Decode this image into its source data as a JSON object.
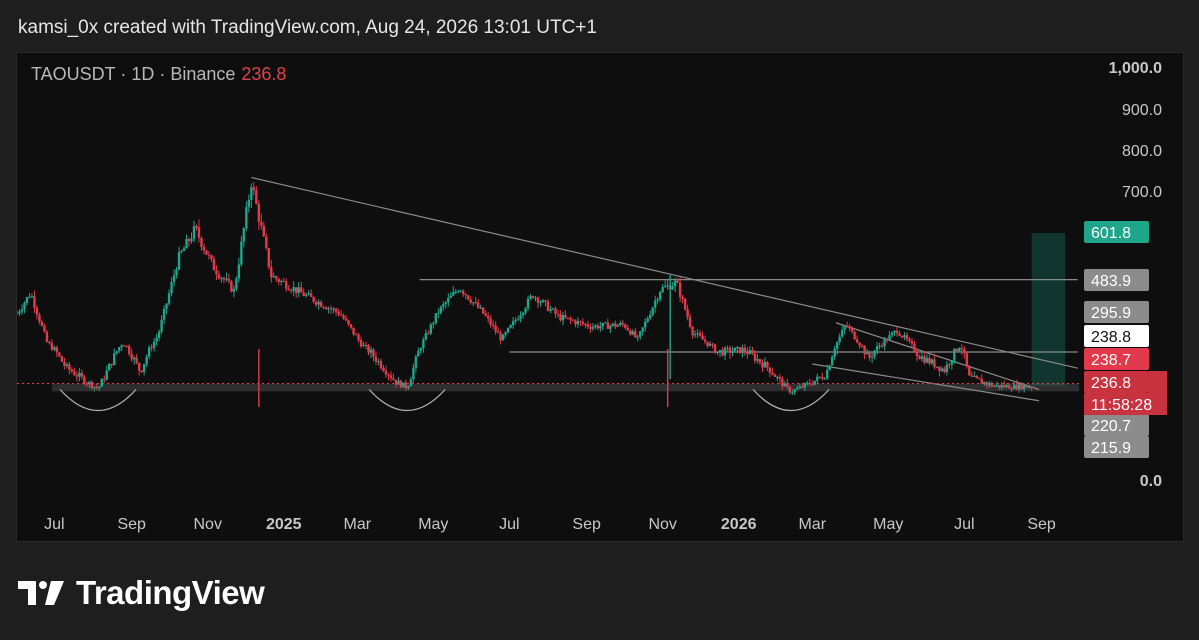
{
  "caption": "kamsi_0x created with TradingView.com, Aug 24, 2026 13:01 UTC+1",
  "header": {
    "symbol_label": "TAOUSDT · 1D · Binance",
    "last_price": "236.8"
  },
  "brand": {
    "name": "TradingView"
  },
  "colors": {
    "up": "#1fa58a",
    "down": "#e23a4a",
    "background": "#0e0e0e",
    "trendline": "#8a8a8a",
    "target_zone": "#123b33"
  },
  "chart_data": {
    "type": "candlestick",
    "title": "TAOUSDT · 1D · Binance",
    "y_scale": "linear-approx",
    "ylim": [
      0,
      1000
    ],
    "x_ticks": [
      {
        "label": "Jul",
        "date": "2024-07-01",
        "bold": false
      },
      {
        "label": "Sep",
        "date": "2024-09-01",
        "bold": false
      },
      {
        "label": "Nov",
        "date": "2024-11-01",
        "bold": false
      },
      {
        "label": "2025",
        "date": "2025-01-01",
        "bold": true
      },
      {
        "label": "Mar",
        "date": "2025-03-01",
        "bold": false
      },
      {
        "label": "May",
        "date": "2025-05-01",
        "bold": false
      },
      {
        "label": "Jul",
        "date": "2025-07-01",
        "bold": false
      },
      {
        "label": "Sep",
        "date": "2025-09-01",
        "bold": false
      },
      {
        "label": "Nov",
        "date": "2025-11-01",
        "bold": false
      },
      {
        "label": "2026",
        "date": "2026-01-01",
        "bold": true
      },
      {
        "label": "Mar",
        "date": "2026-03-01",
        "bold": false
      },
      {
        "label": "May",
        "date": "2026-05-01",
        "bold": false
      },
      {
        "label": "Jul",
        "date": "2026-07-01",
        "bold": false
      },
      {
        "label": "Sep",
        "date": "2026-09-01",
        "bold": false
      }
    ],
    "y_ticks": [
      {
        "label": "1,000.0",
        "value": 1000,
        "bold": true
      },
      {
        "label": "900.0",
        "value": 900,
        "bold": false
      },
      {
        "label": "800.0",
        "value": 800,
        "bold": false
      },
      {
        "label": "700.0",
        "value": 700,
        "bold": false
      },
      {
        "label": "0.0",
        "value": 0,
        "bold": true
      }
    ],
    "price_path": [
      [
        "2024-06-01",
        395
      ],
      [
        "2024-06-12",
        450
      ],
      [
        "2024-06-25",
        318
      ],
      [
        "2024-07-10",
        270
      ],
      [
        "2024-08-05",
        232
      ],
      [
        "2024-08-25",
        318
      ],
      [
        "2024-09-08",
        262
      ],
      [
        "2024-09-22",
        335
      ],
      [
        "2024-10-08",
        535
      ],
      [
        "2024-10-22",
        610
      ],
      [
        "2024-11-05",
        520
      ],
      [
        "2024-11-22",
        455
      ],
      [
        "2024-12-06",
        725
      ],
      [
        "2024-12-22",
        495
      ],
      [
        "2025-01-20",
        440
      ],
      [
        "2025-02-15",
        395
      ],
      [
        "2025-03-05",
        310
      ],
      [
        "2025-04-01",
        245
      ],
      [
        "2025-04-10",
        235
      ],
      [
        "2025-05-05",
        400
      ],
      [
        "2025-05-22",
        465
      ],
      [
        "2025-06-10",
        395
      ],
      [
        "2025-06-25",
        325
      ],
      [
        "2025-07-20",
        445
      ],
      [
        "2025-08-10",
        385
      ],
      [
        "2025-09-05",
        360
      ],
      [
        "2025-10-01",
        365
      ],
      [
        "2025-10-12",
        325
      ],
      [
        "2025-10-30",
        458
      ],
      [
        "2025-11-12",
        478
      ],
      [
        "2025-11-25",
        345
      ],
      [
        "2025-12-15",
        295
      ],
      [
        "2026-01-05",
        300
      ],
      [
        "2026-01-25",
        268
      ],
      [
        "2026-02-12",
        225
      ],
      [
        "2026-03-01",
        245
      ],
      [
        "2026-03-12",
        258
      ],
      [
        "2026-03-28",
        365
      ],
      [
        "2026-04-15",
        283
      ],
      [
        "2026-05-08",
        350
      ],
      [
        "2026-05-25",
        290
      ],
      [
        "2026-06-15",
        265
      ],
      [
        "2026-06-28",
        312
      ],
      [
        "2026-07-05",
        252
      ],
      [
        "2026-07-25",
        238
      ],
      [
        "2026-08-12",
        236
      ],
      [
        "2026-08-24",
        237
      ]
    ],
    "spikes": [
      [
        "2024-12-12",
        190,
        "down"
      ],
      [
        "2025-11-05",
        190,
        "down"
      ],
      [
        "2025-11-07",
        500,
        "up"
      ]
    ],
    "trendlines": [
      {
        "name": "major-downtrend",
        "from": [
          "2024-12-06",
          735
        ],
        "to": [
          "2026-09-30",
          268
        ]
      },
      {
        "name": "wedge-upper",
        "from": [
          "2026-03-20",
          370
        ],
        "to": [
          "2026-08-30",
          230
        ]
      },
      {
        "name": "wedge-lower",
        "from": [
          "2026-03-01",
          275
        ],
        "to": [
          "2026-08-30",
          205
        ]
      },
      {
        "name": "range-high",
        "from": [
          "2025-04-20",
          485
        ],
        "to": [
          "2026-09-30",
          485
        ]
      },
      {
        "name": "range-mid",
        "from": [
          "2025-07-01",
          295
        ],
        "to": [
          "2026-09-30",
          295
        ]
      }
    ],
    "support_zone": [
      226,
      242
    ],
    "current_price_line": 238.8,
    "projection_box": {
      "from": "2026-08-24",
      "to": "2026-09-20",
      "low": 238.8,
      "high": 601.8
    },
    "bottoms_marked": [
      "2024-08-05",
      "2025-04-10",
      "2026-02-12"
    ],
    "price_labels": [
      {
        "label": "601.8",
        "value": 601.8,
        "bg": "#1fa58a",
        "fg": "#ffffff"
      },
      {
        "label": "483.9",
        "value": 483.9,
        "bg": "#8c8c8c",
        "fg": "#ffffff"
      },
      {
        "label": "295.9",
        "value": 295.9,
        "bg": "#8c8c8c",
        "fg": "#ffffff"
      },
      {
        "label": "238.8",
        "value": 238.8,
        "bg": "#ffffff",
        "fg": "#111111"
      },
      {
        "label": "238.7",
        "value": 238.7,
        "bg": "#e23a4a",
        "fg": "#ffffff"
      },
      {
        "label": "236.8",
        "value": 236.8,
        "bg": "#c9323f",
        "fg": "#ffffff"
      },
      {
        "label": "220.7",
        "value": 220.7,
        "bg": "#8c8c8c",
        "fg": "#ffffff"
      },
      {
        "label": "215.9",
        "value": 215.9,
        "bg": "#8c8c8c",
        "fg": "#ffffff"
      }
    ],
    "countdown": "11:58:28"
  }
}
